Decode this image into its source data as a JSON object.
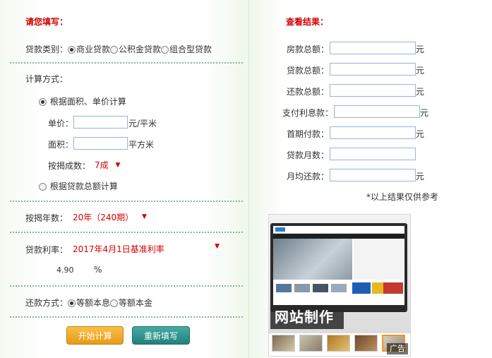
{
  "left": {
    "heading": "请您填写：",
    "loan_type": {
      "label": "贷款类别：",
      "options": [
        "商业贷款",
        "公积金贷款",
        "组合型贷款"
      ],
      "selected_index": 0
    },
    "calc_method": {
      "label": "计算方式：",
      "option_area": "根据面积、单价计算",
      "option_total": "根据贷款总额计算",
      "unit_price_label": "单价：",
      "unit_price_value": "",
      "unit_price_unit": "元/平米",
      "area_label": "面积：",
      "area_value": "",
      "area_unit": "平方米",
      "mortgage_ratio_label": "按揭成数：",
      "mortgage_ratio_value": "7成"
    },
    "years": {
      "label": "按揭年数：",
      "value": "20年（240期）"
    },
    "rate": {
      "label": "贷款利率：",
      "value": "2017年4月1日基准利率",
      "rate_value": "4.90",
      "percent_sign": "%"
    },
    "repay": {
      "label": "还款方式：",
      "options": [
        "等额本息",
        "等额本金"
      ],
      "selected_index": 0
    },
    "buttons": {
      "calculate": "开始计算",
      "reset": "重新填写"
    }
  },
  "right": {
    "heading": "查看结果：",
    "results": [
      {
        "label": "房款总额：",
        "value": "",
        "unit": "元"
      },
      {
        "label": "贷款总额：",
        "value": "",
        "unit": "元"
      },
      {
        "label": "还款总额：",
        "value": "",
        "unit": "元"
      },
      {
        "label": "支付利息款：",
        "value": "",
        "unit": "元"
      },
      {
        "label": "首期付款：",
        "value": "",
        "unit": "元"
      },
      {
        "label": "贷款月数：",
        "value": "",
        "unit": ""
      },
      {
        "label": "月均还款：",
        "value": "",
        "unit": "元"
      }
    ],
    "note": "*以上结果仅供参考",
    "ad": {
      "banner_text": "网站制作",
      "label": "广告"
    }
  },
  "colors": {
    "accent_red": "#d60000",
    "input_border": "#8fb8d7",
    "calc_button": "#f0aa22",
    "reset_button": "#2f948c"
  }
}
